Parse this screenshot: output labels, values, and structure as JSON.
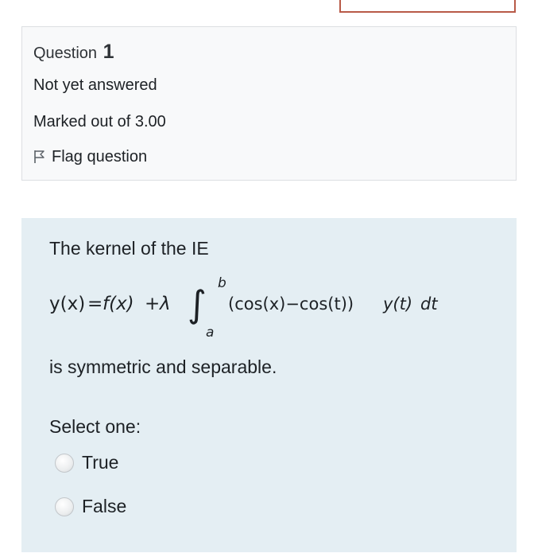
{
  "question_info": {
    "label": "Question",
    "number": "1",
    "state": "Not yet answered",
    "grade": "Marked out of 3.00",
    "flag_label": "Flag question"
  },
  "question": {
    "text_before": "The kernel of the IE",
    "formula": {
      "lhs": "y(x)",
      "equals": "=",
      "f_term": "f(x)",
      "plus": "+",
      "lambda": "λ",
      "integral_sign": "∫",
      "upper_limit": "b",
      "lower_limit": "a",
      "kernel": "(cos(x)−cos(t))",
      "y_t": "y(t)",
      "dt": "dt"
    },
    "text_after": "is symmetric and separable.",
    "prompt": "Select one:",
    "options": [
      {
        "label": "True",
        "selected": false
      },
      {
        "label": "False",
        "selected": false
      }
    ]
  },
  "colors": {
    "content_background": "#e4eef3",
    "info_background": "#f8f9fa",
    "top_button_border": "#b85a48"
  }
}
